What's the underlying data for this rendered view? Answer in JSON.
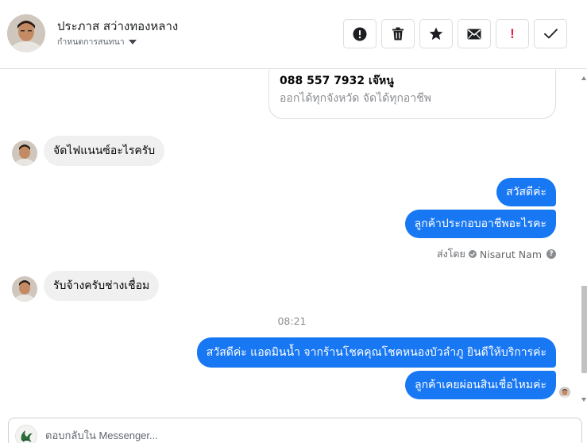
{
  "header": {
    "contact_name": "ประภาส สว่างทองหลาง",
    "contact_sub": "กำหนดการสนทนา",
    "actions": [
      {
        "name": "spam-button",
        "icon": "alert-circle-icon"
      },
      {
        "name": "delete-button",
        "icon": "trash-icon"
      },
      {
        "name": "star-button",
        "icon": "star-icon"
      },
      {
        "name": "mark-unread-button",
        "icon": "envelope-icon"
      },
      {
        "name": "mark-important-button",
        "icon": "exclamation-icon",
        "label": "!"
      },
      {
        "name": "mark-done-button",
        "icon": "checkmark-icon"
      }
    ]
  },
  "conversation": {
    "card": {
      "phone": "088 557 7932 เจ๊หนู",
      "subtitle": "ออกได้ทุกจังหวัด จัดได้ทุกอาชีพ"
    },
    "messages": [
      {
        "direction": "in",
        "text": "จัดไฟแนนซ์อะไรครับ"
      },
      {
        "direction": "out",
        "text": "สวัสดีค่ะ"
      },
      {
        "direction": "out",
        "text": "ลูกค้าประกอบอาชีพอะไรคะ"
      },
      {
        "direction": "in",
        "text": "รับจ้างครับช่างเชื่อม"
      },
      {
        "direction": "out",
        "text": "สวัสดีค่ะ แอดมินน้ำ จากร้านโชคคุณโชคหนองบัวลำภู ยินดีให้บริการค่ะ"
      },
      {
        "direction": "out",
        "text": "ลูกค้าเคยผ่อนสินเชื่อไหมค่ะ"
      }
    ],
    "sent_by": {
      "prefix": "ส่งโดย",
      "name": "Nisarut Nam",
      "help_label": "?"
    },
    "time_separator": "08:21"
  },
  "composer": {
    "placeholder": "ตอบกลับใน Messenger..."
  },
  "colors": {
    "accent": "#1877f2",
    "incoming_bubble": "#f0f0f0",
    "important": "#e41e3f"
  }
}
